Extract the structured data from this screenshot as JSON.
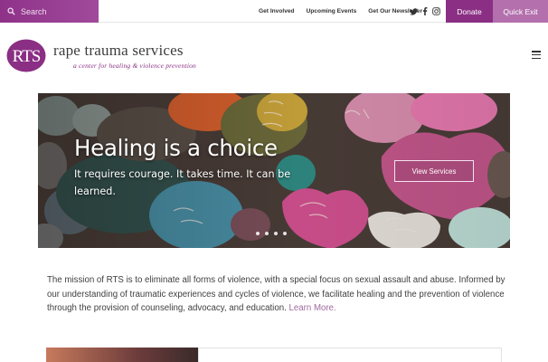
{
  "topbar": {
    "search_placeholder": "Search",
    "links": [
      "Get Involved",
      "Upcoming Events",
      "Get Our Newsletter"
    ],
    "social_icons": [
      "twitter-icon",
      "facebook-icon",
      "instagram-icon"
    ],
    "donate_label": "Donate",
    "quick_exit_label": "Quick Exit"
  },
  "logo": {
    "mark": "RTS",
    "name": "rape trauma services",
    "tagline": "a center for healing & violence prevention"
  },
  "hero": {
    "title": "Healing is a choice",
    "subtitle": "It requires courage. It takes time. It can be learned.",
    "button_label": "View Services",
    "slide_count": 4,
    "active_slide": 1
  },
  "mission": {
    "text": "The mission of RTS is to eliminate all forms of violence, with a special focus on sexual assault and abuse. Informed by our understanding of traumatic experiences and cycles of violence, we facilitate healing and the prevention of violence through the provision of counseling, advocacy, and education.",
    "link_label": "Learn More."
  },
  "colors": {
    "brand_purple": "#8a2f84",
    "quick_exit": "#b370ad",
    "link": "#a06aa0"
  }
}
